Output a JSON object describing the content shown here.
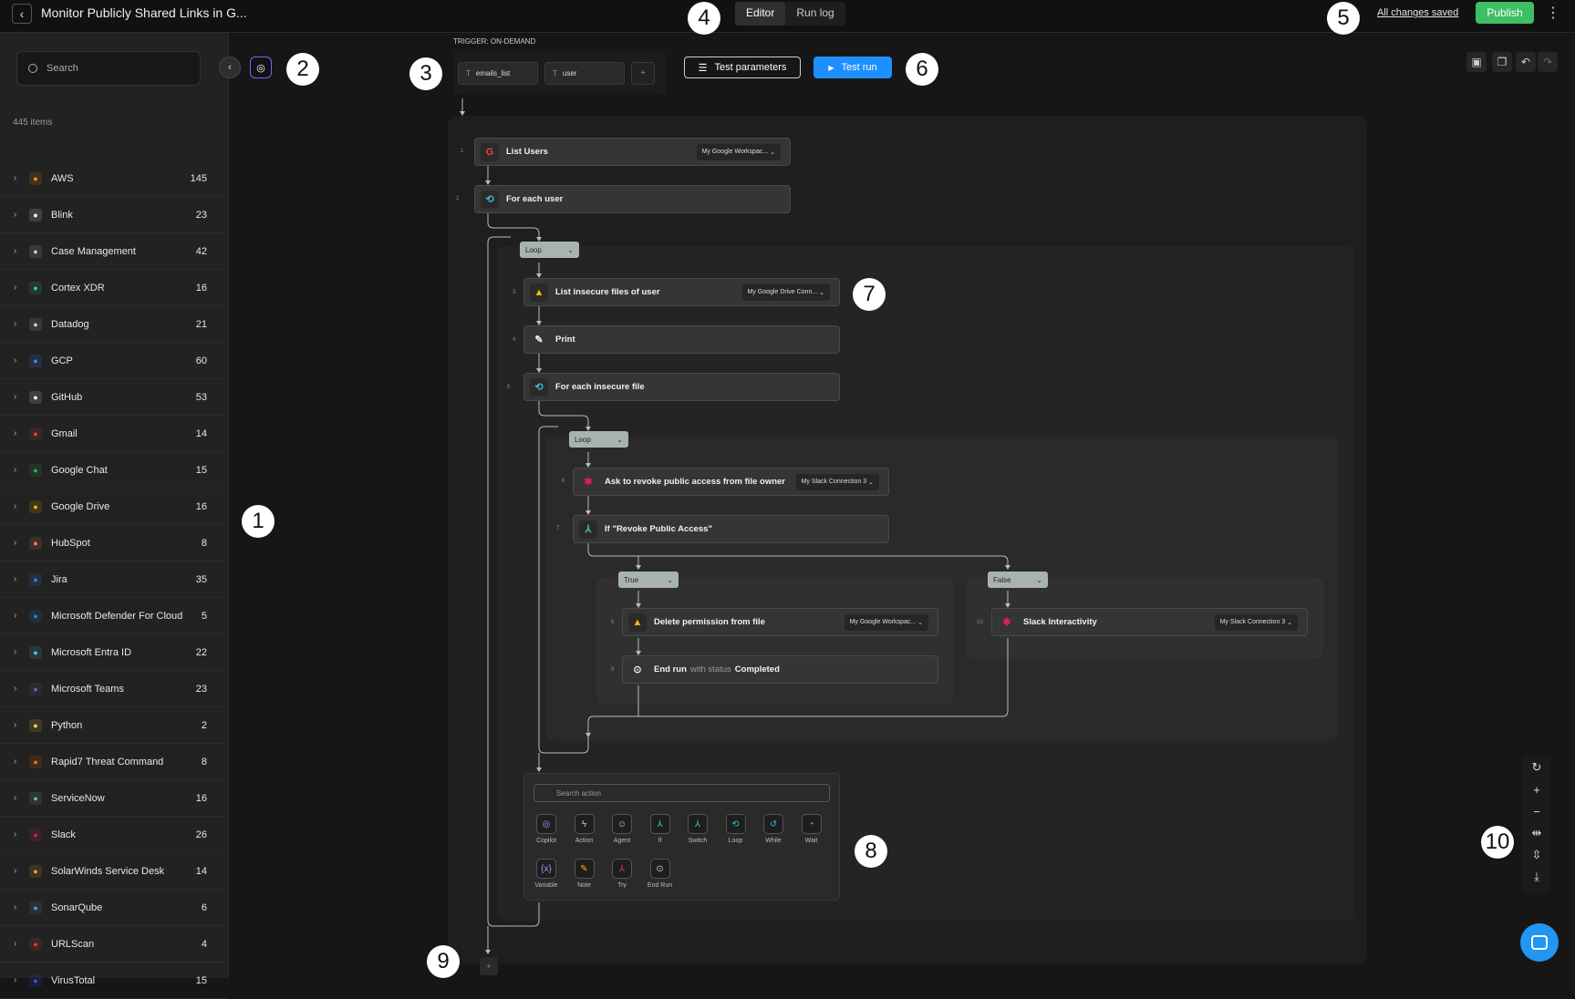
{
  "topbar": {
    "title": "Monitor Publicly Shared Links in G...",
    "tabs": [
      "Editor",
      "Run log"
    ],
    "saved": "All changes saved",
    "publish": "Publish"
  },
  "sidebar": {
    "search_placeholder": "Search",
    "count": "445 items",
    "items": [
      {
        "label": "AWS",
        "count": "145",
        "icon": "aws",
        "color": "#ff9900"
      },
      {
        "label": "Blink",
        "count": "23",
        "icon": "blink",
        "color": "#ffffff"
      },
      {
        "label": "Case Management",
        "count": "42",
        "icon": "case",
        "color": "#cccccc"
      },
      {
        "label": "Cortex XDR",
        "count": "16",
        "icon": "cortex",
        "color": "#38d27a"
      },
      {
        "label": "Datadog",
        "count": "21",
        "icon": "datadog",
        "color": "#cccccc"
      },
      {
        "label": "GCP",
        "count": "60",
        "icon": "gcp",
        "color": "#4285f4"
      },
      {
        "label": "GitHub",
        "count": "53",
        "icon": "github",
        "color": "#ffffff"
      },
      {
        "label": "Gmail",
        "count": "14",
        "icon": "gmail",
        "color": "#ea4335"
      },
      {
        "label": "Google Chat",
        "count": "15",
        "icon": "gchat",
        "color": "#34a853"
      },
      {
        "label": "Google Drive",
        "count": "16",
        "icon": "gdrive",
        "color": "#fbbc04"
      },
      {
        "label": "HubSpot",
        "count": "8",
        "icon": "hubspot",
        "color": "#ff7a59"
      },
      {
        "label": "Jira",
        "count": "35",
        "icon": "jira",
        "color": "#2684ff"
      },
      {
        "label": "Microsoft Defender For Cloud",
        "count": "5",
        "icon": "defender",
        "color": "#1e88e5"
      },
      {
        "label": "Microsoft Entra ID",
        "count": "22",
        "icon": "entra",
        "color": "#4fc3f7"
      },
      {
        "label": "Microsoft Teams",
        "count": "23",
        "icon": "teams",
        "color": "#6264a7"
      },
      {
        "label": "Python",
        "count": "2",
        "icon": "python",
        "color": "#ffd43b"
      },
      {
        "label": "Rapid7 Threat Command",
        "count": "8",
        "icon": "rapid7",
        "color": "#ff6a00"
      },
      {
        "label": "ServiceNow",
        "count": "16",
        "icon": "servicenow",
        "color": "#81b5a1"
      },
      {
        "label": "Slack",
        "count": "26",
        "icon": "slack",
        "color": "#e01e5a"
      },
      {
        "label": "SolarWinds Service Desk",
        "count": "14",
        "icon": "solarwinds",
        "color": "#f5a623"
      },
      {
        "label": "SonarQube",
        "count": "6",
        "icon": "sonarqube",
        "color": "#4e9bcd"
      },
      {
        "label": "URLScan",
        "count": "4",
        "icon": "urlscan",
        "color": "#e53935"
      },
      {
        "label": "VirusTotal",
        "count": "15",
        "icon": "virustotal",
        "color": "#394eff"
      }
    ]
  },
  "trigger": {
    "label": "TRIGGER: ON-DEMAND",
    "params": [
      "emails_list",
      "user"
    ]
  },
  "toolbar": {
    "test_params": "Test parameters",
    "test_run": "Test run"
  },
  "flow": {
    "n1": {
      "num": "1",
      "label": "List Users",
      "conn": "My Google Workspac..."
    },
    "n2": {
      "num": "2",
      "label": "For each user"
    },
    "loop1": "Loop",
    "n3": {
      "num": "3",
      "label": "List insecure files of user",
      "conn": "My Google Drive Conn..."
    },
    "n4": {
      "num": "4",
      "label": "Print"
    },
    "n5": {
      "num": "5",
      "label": "For each insecure file"
    },
    "loop2": "Loop",
    "n6": {
      "num": "6",
      "label": "Ask to revoke public access from file owner",
      "conn": "My Slack Connection 3"
    },
    "n7": {
      "num": "7",
      "label": "If \"Revoke Public Access\""
    },
    "true_tag": "True",
    "false_tag": "False",
    "n8": {
      "num": "8",
      "label": "Delete permission from file",
      "conn": "My Google Workspac..."
    },
    "n9": {
      "num": "9",
      "label": "End run",
      "muted": "with status",
      "status": "Completed"
    },
    "n10": {
      "num": "10",
      "label": "Slack Interactivity",
      "conn": "My Slack Connection 3"
    }
  },
  "palette": {
    "placeholder": "Search action",
    "items": [
      "Copilot",
      "Action",
      "Agent",
      "If",
      "Switch",
      "Loop",
      "While",
      "Wait",
      "Variable",
      "Note",
      "Try",
      "End Run"
    ]
  },
  "callouts": [
    "1",
    "2",
    "3",
    "4",
    "5",
    "6",
    "7",
    "8",
    "9",
    "10"
  ]
}
